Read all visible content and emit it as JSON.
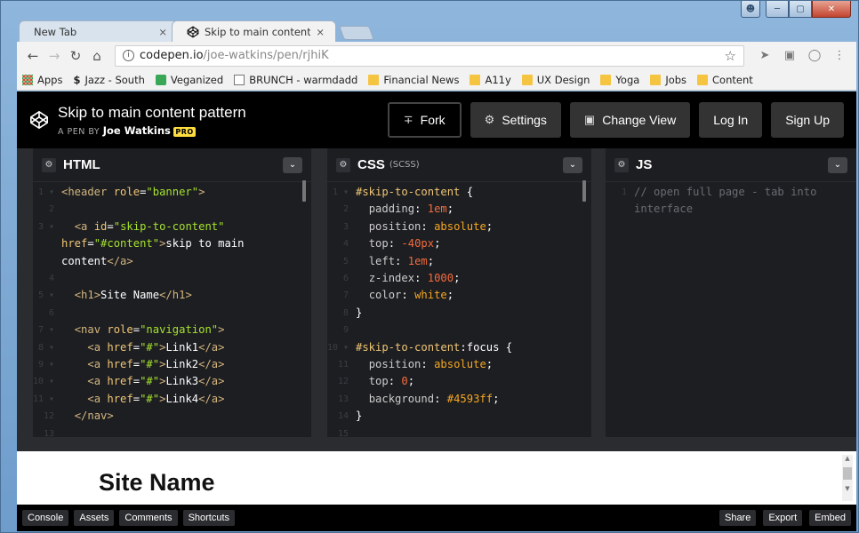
{
  "browser": {
    "tabs": [
      {
        "label": "New Tab",
        "active": false
      },
      {
        "label": "Skip to main content pat",
        "active": true
      }
    ],
    "url_host": "codepen.io",
    "url_path": "/joe-watkins/pen/rjhiK",
    "bookmarks": [
      {
        "label": "Apps",
        "icon": "apps-grid-icon"
      },
      {
        "label": "Jazz - South",
        "icon": "dollar-icon"
      },
      {
        "label": "Veganized",
        "icon": "green-square-icon"
      },
      {
        "label": "BRUNCH - warmdadd",
        "icon": "page-icon"
      },
      {
        "label": "Financial News",
        "icon": "folder-icon"
      },
      {
        "label": "A11y",
        "icon": "folder-icon"
      },
      {
        "label": "UX Design",
        "icon": "folder-icon"
      },
      {
        "label": "Yoga",
        "icon": "folder-icon"
      },
      {
        "label": "Jobs",
        "icon": "folder-icon"
      },
      {
        "label": "Content",
        "icon": "folder-icon"
      }
    ]
  },
  "codepen": {
    "pen_title": "Skip to main content pattern",
    "byline_prefix": "A PEN BY",
    "author": "Joe Watkins",
    "pro_badge": "PRO",
    "buttons": {
      "fork": "Fork",
      "settings": "Settings",
      "change_view": "Change View",
      "login": "Log In",
      "signup": "Sign Up"
    }
  },
  "editors": {
    "html": {
      "name": "HTML",
      "sub": ""
    },
    "css": {
      "name": "CSS",
      "sub": "(SCSS)"
    },
    "js": {
      "name": "JS",
      "sub": ""
    }
  },
  "preview": {
    "site_name": "Site Name"
  },
  "footer": {
    "left": [
      "Console",
      "Assets",
      "Comments",
      "Shortcuts"
    ],
    "right": [
      "Share",
      "Export",
      "Embed"
    ]
  }
}
